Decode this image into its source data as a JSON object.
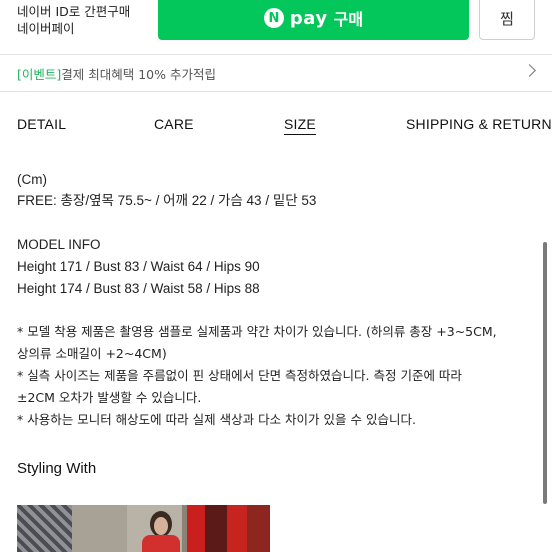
{
  "npay": {
    "info_line1": "네이버 ID로 간편구매",
    "info_line2": "네이버페이",
    "logo_letter": "N",
    "button_label": "pay",
    "button_suffix": "구매",
    "zzim_label": "찜"
  },
  "event": {
    "tag": "[이벤트]",
    "text": "결제 최대혜택 10% 추가적립"
  },
  "tabs": [
    {
      "label": "DETAIL"
    },
    {
      "label": "CARE"
    },
    {
      "label": "SIZE",
      "active": true
    },
    {
      "label": "SHIPPING & RETURN"
    }
  ],
  "size_info": {
    "unit": "(Cm)",
    "free_line": "FREE: 총장/옆목 75.5~ / 어깨 22 / 가슴 43 / 밑단 53"
  },
  "model_info": {
    "heading": "MODEL INFO",
    "lines": [
      "Height 171 / Bust 83 / Waist 64 / Hips 90",
      "Height 174 / Bust 83 / Waist 58 / Hips 88"
    ]
  },
  "notes": [
    "* 모델 착용 제품은 촬영용 샘플로 실제품과 약간 차이가 있습니다. (하의류 총장 +3~5CM,",
    "상의류 소매길이 +2~4CM)",
    "* 실측 사이즈는 제품을 주름없이 핀 상태에서 단면 측정하였습니다. 측정 기준에 따라",
    "±2CM 오차가 발생할 수 있습니다.",
    "* 사용하는 모니터 해상도에 따라 실제 색상과 다소 차이가 있을 수 있습니다."
  ],
  "styling": {
    "title": "Styling With"
  }
}
